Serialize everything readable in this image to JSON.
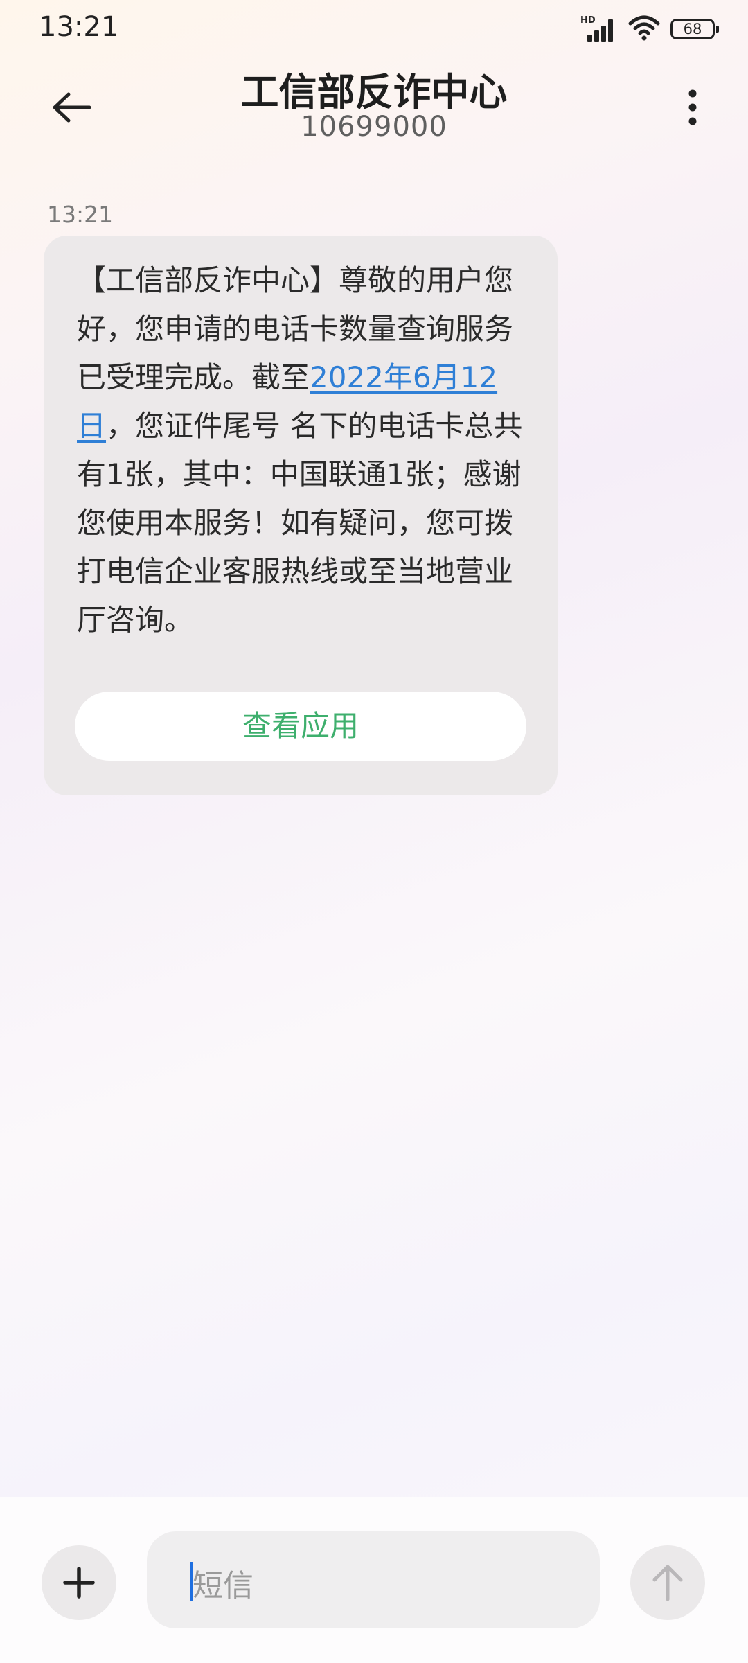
{
  "status_bar": {
    "time": "13:21",
    "network_label": "HD",
    "battery": "68",
    "icons": [
      "signal-icon",
      "wifi-icon",
      "battery-icon"
    ]
  },
  "header": {
    "title": "工信部反诈中心",
    "number": "10699000",
    "back_icon": "back-arrow-icon",
    "more_icon": "more-vertical-icon"
  },
  "conversation": {
    "timestamp": "13:21",
    "message": {
      "text_before": "【工信部反诈中心】尊敬的用户您好，您申请的电话卡数量查询服务已受理完成。截至",
      "date_link": "2022年6月12日",
      "text_after": "，您证件尾号    名下的电话卡总共有1张，其中：中国联通1张；感谢您使用本服务！如有疑问，您可拨打电信企业客服热线或至当地营业厅咨询。",
      "action_button": "查看应用"
    }
  },
  "composer": {
    "placeholder": "短信",
    "add_icon": "plus-icon",
    "send_icon": "send-arrow-icon"
  },
  "colors": {
    "link": "#2f7fd6",
    "action": "#3eaf6d",
    "caret": "#1f6fe0",
    "bubble": "#ece9ea"
  }
}
